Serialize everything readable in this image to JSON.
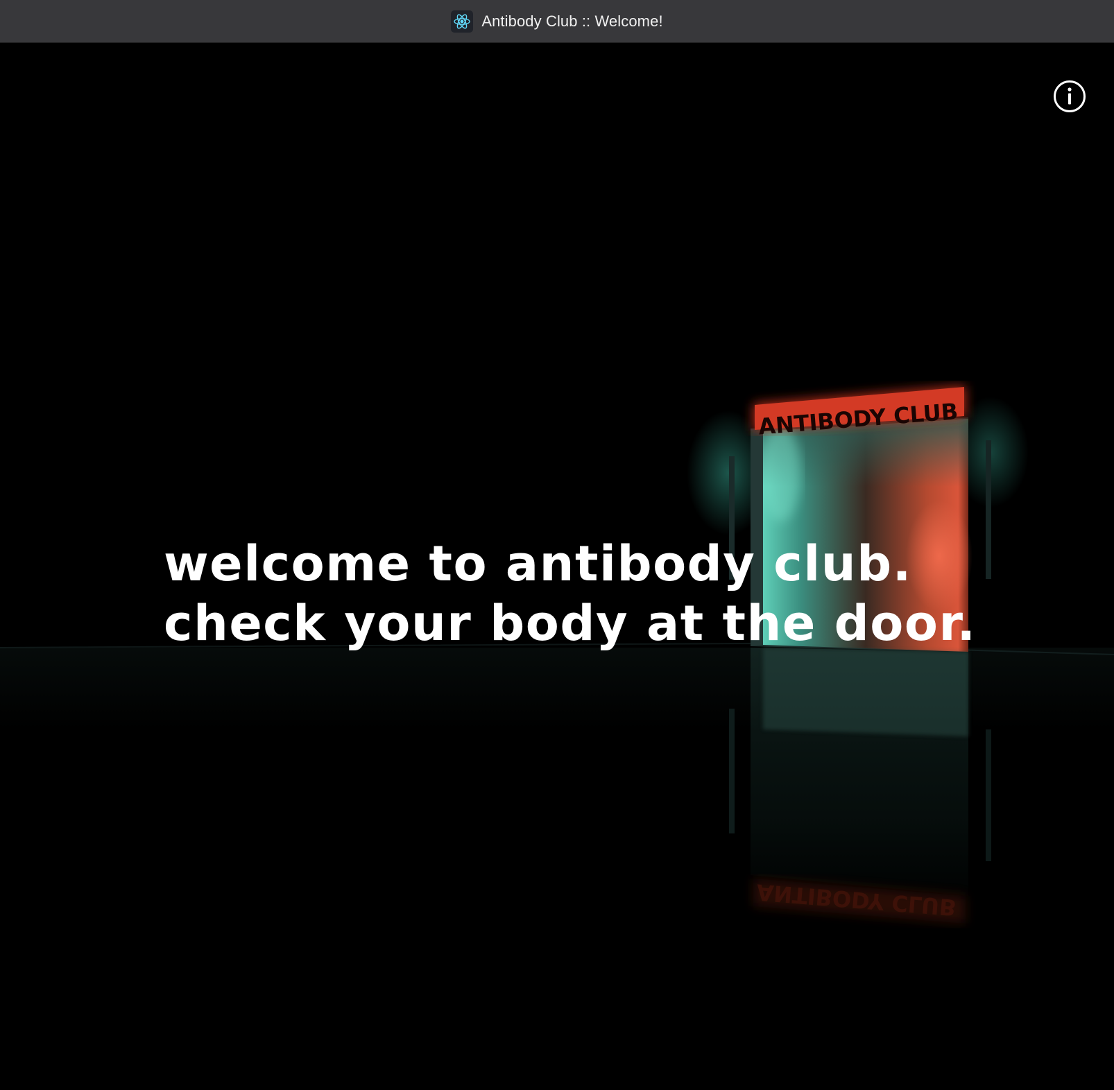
{
  "window": {
    "title": "Antibody Club :: Welcome!",
    "app_icon": "react-atom-icon"
  },
  "scene": {
    "sign_text": "ANTIBODY CLUB",
    "info_icon": "info-icon",
    "headline": {
      "line1": "welcome to antibody club.",
      "line2": "check your body at the door."
    }
  },
  "colors": {
    "background": "#000000",
    "titlebar": "#38383b",
    "neon_red": "#e8452c",
    "neon_teal": "#5fd6c0",
    "text": "#ffffff"
  }
}
